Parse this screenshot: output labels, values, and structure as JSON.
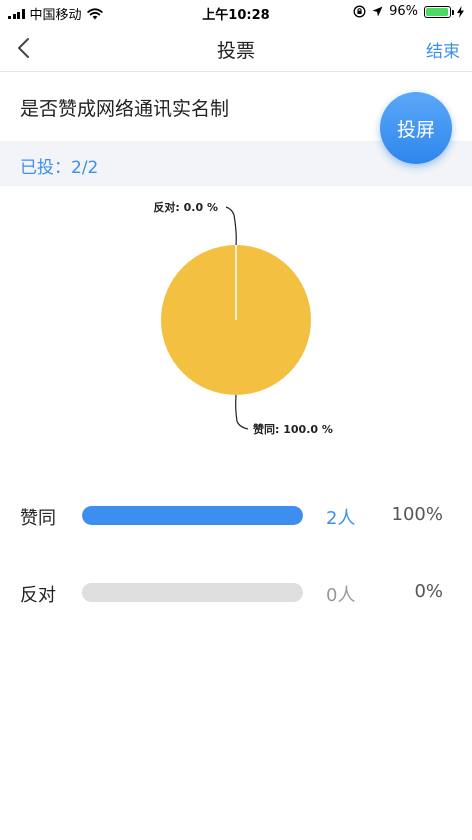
{
  "status_bar": {
    "carrier": "中国移动",
    "time": "上午10:28",
    "battery_pct": "96%",
    "battery_level": 0.96
  },
  "nav": {
    "title": "投票",
    "end_label": "结束"
  },
  "question": "是否赞成网络通讯实名制",
  "screen_button_label": "投屏",
  "voted_text": "已投：2/2",
  "chart_data": {
    "type": "pie",
    "colors": {
      "approve": "#f3c042",
      "oppose": "#3d8fef"
    },
    "slices": [
      {
        "label": "反对: 0.0 %",
        "value": 0.0
      },
      {
        "label": "赞同: 100.0 %",
        "value": 100.0
      }
    ]
  },
  "results": [
    {
      "label": "赞同",
      "count": "2人",
      "percent": "100%",
      "fraction": 1.0,
      "count_color": "#3d8fef"
    },
    {
      "label": "反对",
      "count": "0人",
      "percent": "0%",
      "fraction": 0.0,
      "count_color": "#999999"
    }
  ]
}
